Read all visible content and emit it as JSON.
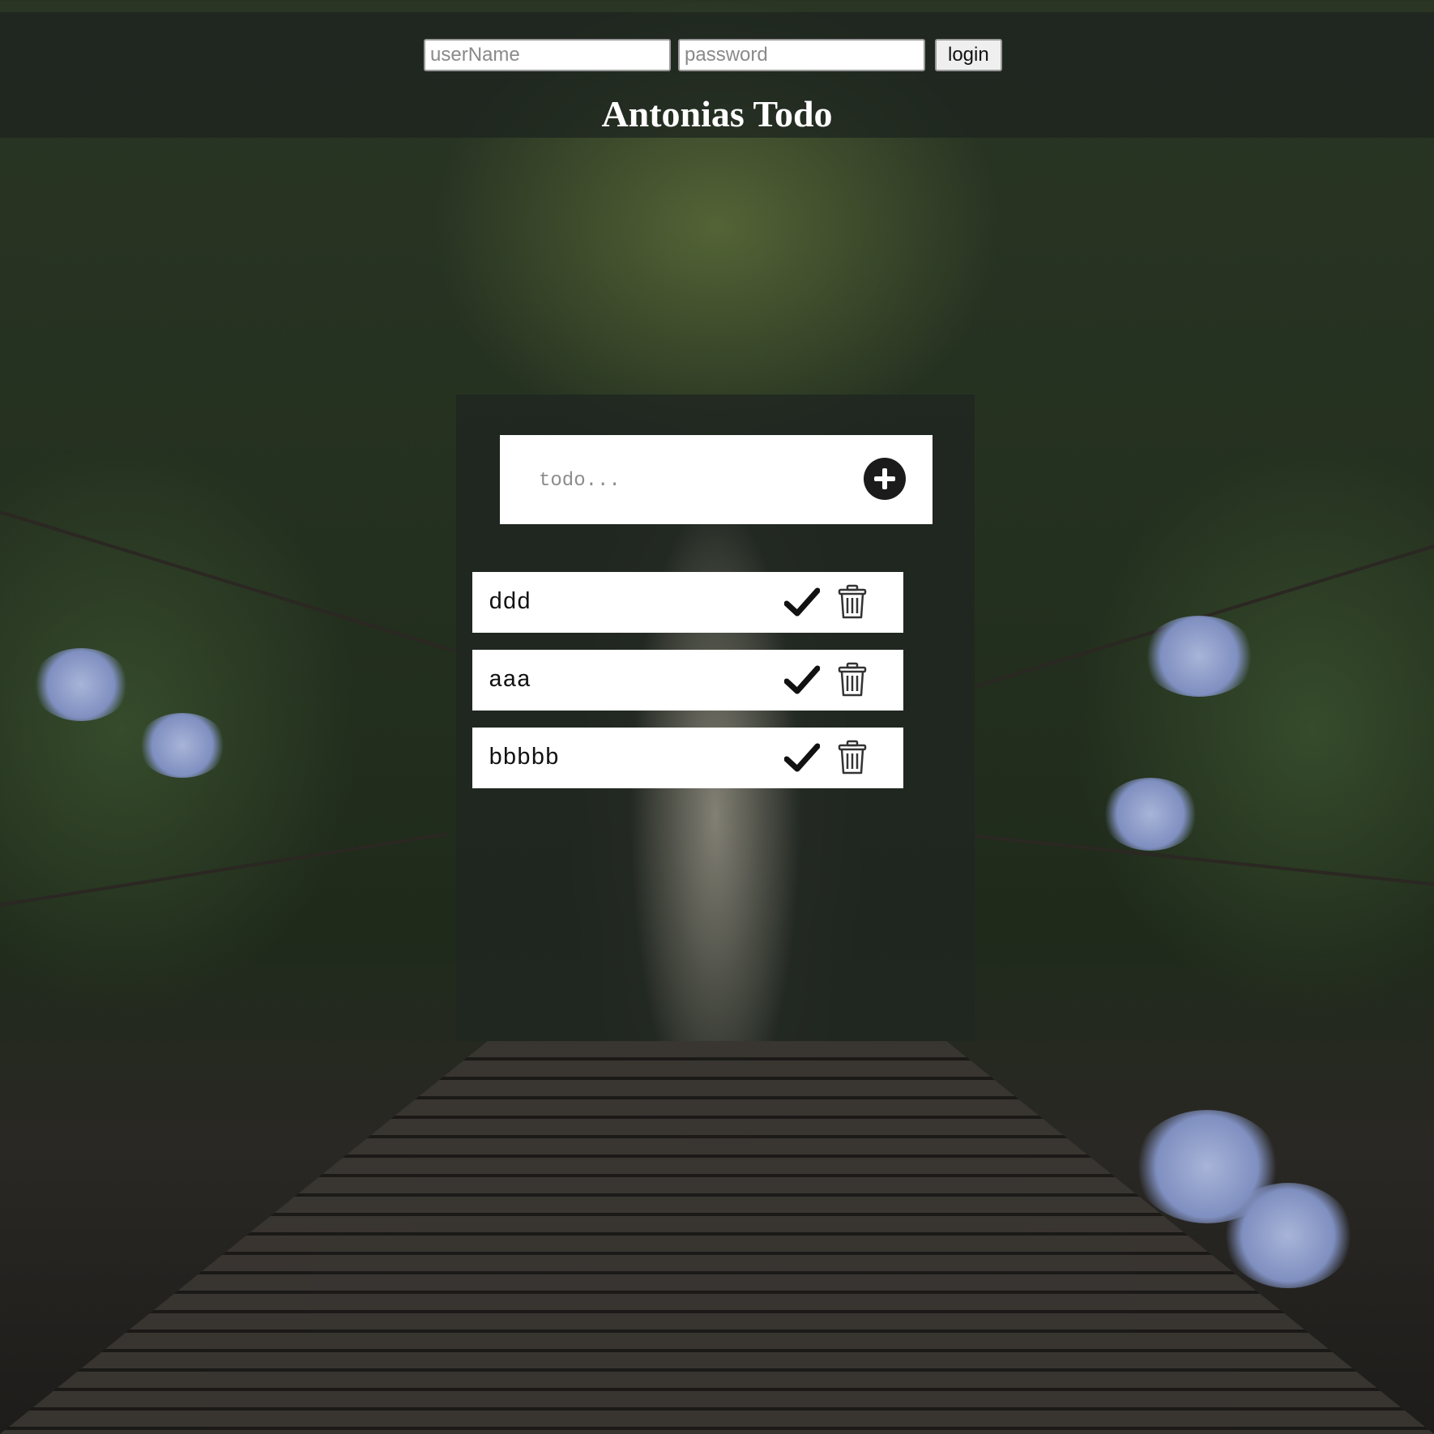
{
  "header": {
    "username_placeholder": "userName",
    "password_placeholder": "password",
    "login_label": "login",
    "title": "Antonias Todo"
  },
  "todo": {
    "input_placeholder": "todo...",
    "add_icon": "plus-circle-icon",
    "items": [
      {
        "text": "ddd",
        "complete_icon": "checkmark-icon",
        "delete_icon": "trash-icon"
      },
      {
        "text": "aaa",
        "complete_icon": "checkmark-icon",
        "delete_icon": "trash-icon"
      },
      {
        "text": "bbbbb",
        "complete_icon": "checkmark-icon",
        "delete_icon": "trash-icon"
      }
    ]
  },
  "colors": {
    "header_overlay": "#1c221e",
    "panel_overlay": "#202621",
    "card_background": "#ffffff",
    "icon_color": "#1b1b1b",
    "title_color": "#ffffff"
  }
}
